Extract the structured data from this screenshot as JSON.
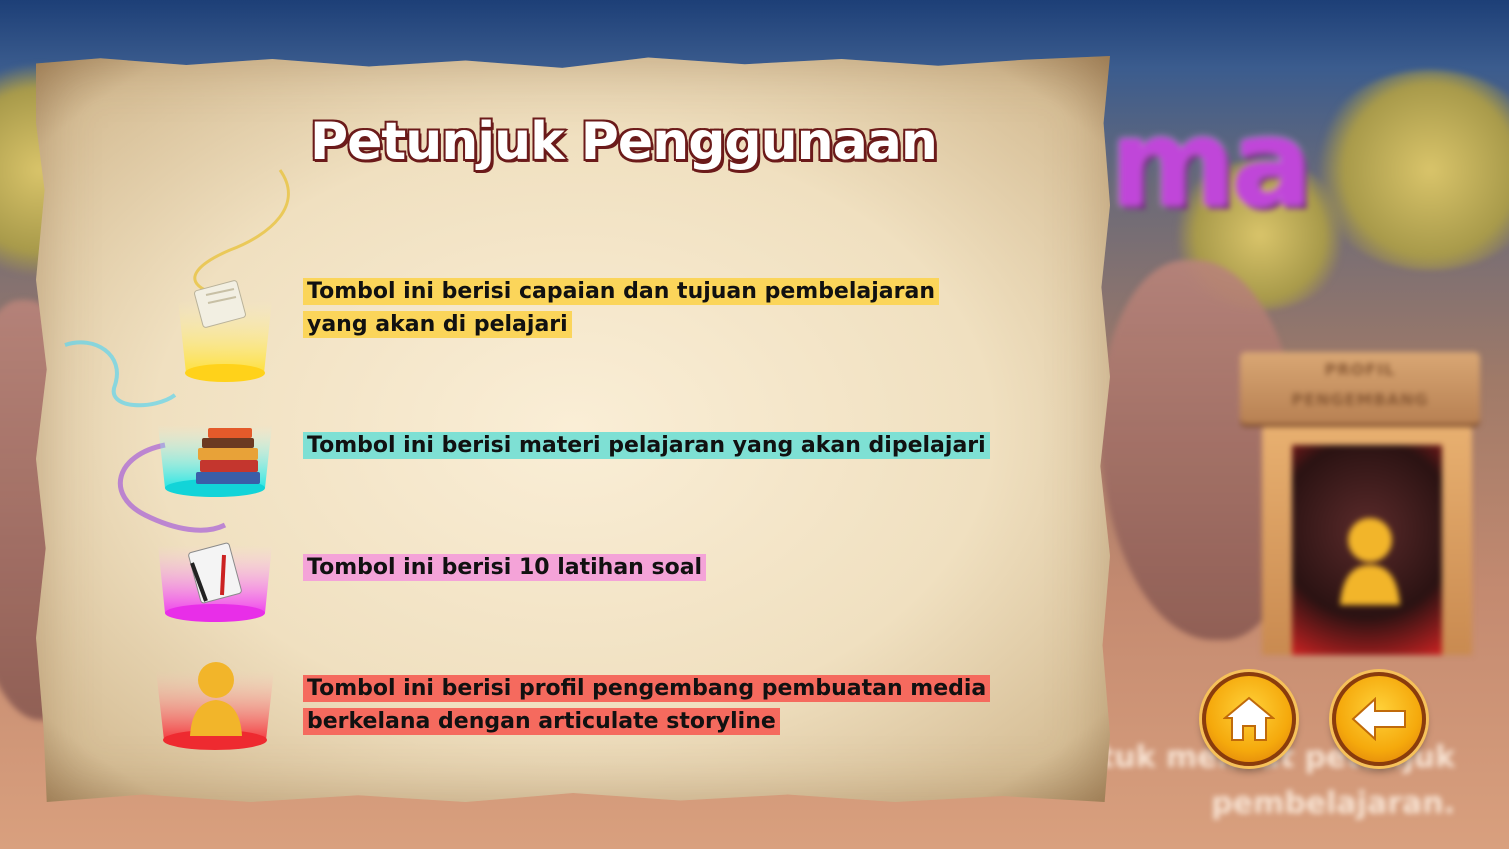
{
  "background": {
    "title_fragment": "ma",
    "sign_line1": "PROFIL",
    "sign_line2": "PENGEMBANG",
    "bottom_text": "na. Klik peta yang dipegang Olo untuk melihat petunjuk pembelajaran."
  },
  "panel": {
    "title": "Petunjuk Penggunaan",
    "items": [
      {
        "icon": "scroll-icon",
        "text": "Tombol ini berisi capaian dan tujuan pembelajaran yang akan di pelajari",
        "color": "#fbd55a"
      },
      {
        "icon": "books-icon",
        "text": "Tombol ini  berisi materi pelajaran yang akan dipelajari",
        "color": "#7ee0d4"
      },
      {
        "icon": "notepad-icon",
        "text": "Tombol ini  berisi 10 latihan soal",
        "color": "#f4a3d8"
      },
      {
        "icon": "person-icon",
        "text": "Tombol ini  berisi profil pengembang pembuatan media berkelana dengan articulate storyline",
        "color": "#f56a5e"
      }
    ]
  },
  "nav": {
    "home_icon": "home-icon",
    "back_icon": "back-arrow-icon"
  },
  "colors": {
    "yellow_pedestal": "#ffe033",
    "cyan_pedestal": "#1fe6e6",
    "magenta_pedestal": "#f03cf0",
    "red_pedestal": "#f5333a",
    "button_gold": "#f5a90c"
  }
}
